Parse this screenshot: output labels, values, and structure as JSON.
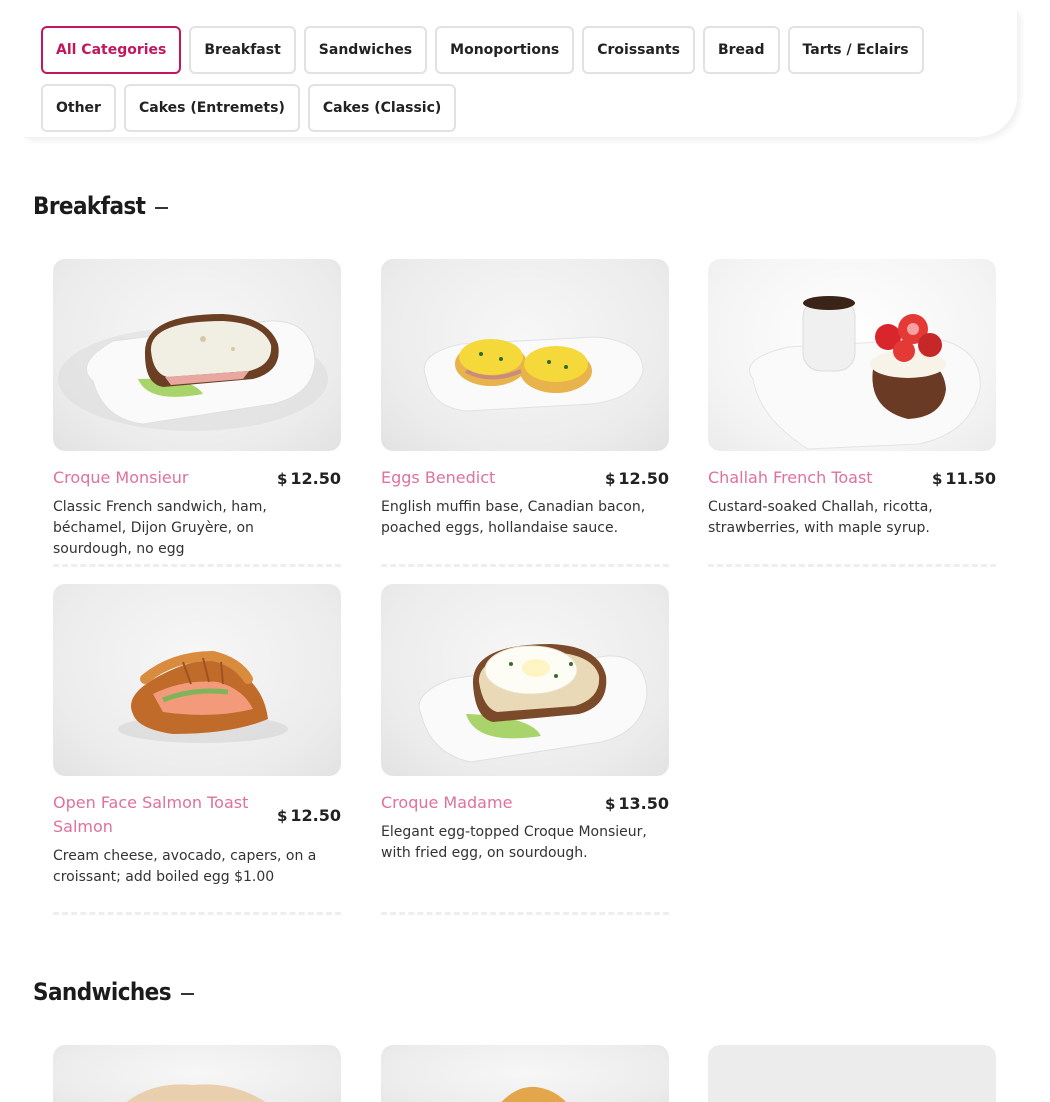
{
  "categories": [
    {
      "label": "All Categories",
      "active": true
    },
    {
      "label": "Breakfast"
    },
    {
      "label": "Sandwiches"
    },
    {
      "label": "Monoportions"
    },
    {
      "label": "Croissants"
    },
    {
      "label": "Bread"
    },
    {
      "label": "Tarts / Eclairs"
    },
    {
      "label": "Other"
    },
    {
      "label": "Cakes (Entremets)"
    },
    {
      "label": "Cakes (Classic)"
    }
  ],
  "sections": {
    "breakfast": {
      "title": "Breakfast",
      "items": [
        {
          "name": "Croque Monsieur",
          "currency": "$",
          "price": "12.50",
          "description": "Classic French sandwich, ham, béchamel, Dijon Gruyère, on sourdough, no egg",
          "icon": "croque-monsieur-photo"
        },
        {
          "name": "Eggs Benedict",
          "currency": "$",
          "price": "12.50",
          "description": "English muffin base, Canadian bacon, poached eggs, hollandaise sauce.",
          "icon": "eggs-benedict-photo"
        },
        {
          "name": "Challah French Toast",
          "currency": "$",
          "price": "11.50",
          "description": "Custard-soaked Challah, ricotta, strawberries, with maple syrup.",
          "icon": "french-toast-photo"
        },
        {
          "name": "Open Face Salmon Toast Salmon",
          "currency": "$",
          "price": "12.50",
          "description": "Cream cheese, avocado, capers, on a croissant; add boiled egg $1.00",
          "icon": "salmon-croissant-photo"
        },
        {
          "name": "Croque Madame",
          "currency": "$",
          "price": "13.50",
          "description": "Elegant egg-topped Croque Monsieur, with fried egg, on sourdough.",
          "icon": "croque-madame-photo"
        }
      ]
    },
    "sandwiches": {
      "title": "Sandwiches"
    }
  },
  "colors": {
    "accent": "#c2185b",
    "item_name": "#e0709c"
  }
}
